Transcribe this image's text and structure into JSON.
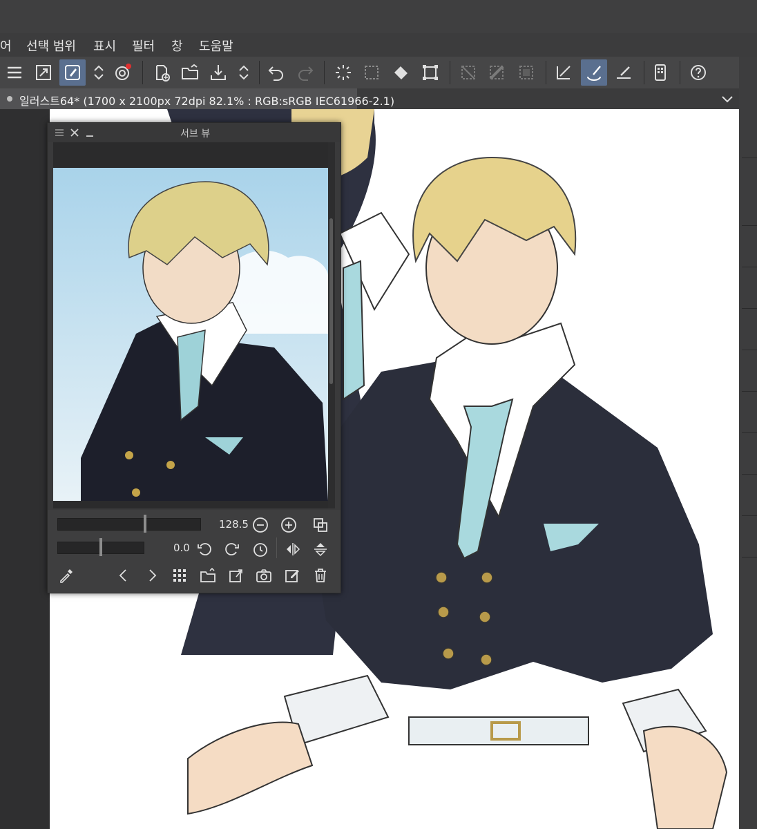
{
  "menu": {
    "items": [
      "어",
      "선택 범위",
      "표시",
      "필터",
      "창",
      "도움말"
    ]
  },
  "toolbar": {
    "icons": [
      "menu-icon",
      "fit-view-icon",
      "brush-active-icon",
      "up-down-arrows-icon",
      "cloud-sync-icon",
      "new-file-icon",
      "open-folder-icon",
      "export-icon",
      "up-down-arrows-icon",
      "undo-icon",
      "redo-icon",
      "auto-select-icon",
      "selection-invert-icon",
      "fill-icon",
      "transform-icon",
      "clear-selection-icon",
      "deselect-icon",
      "border-icon",
      "ruler-icon",
      "brush-settings-icon",
      "pen-line-icon",
      "device-icon",
      "help-icon"
    ]
  },
  "document": {
    "tab_label": "일러스트64* (1700 x 2100px 72dpi 82.1% : RGB:sRGB IEC61966-2.1)"
  },
  "subview": {
    "title": "서브 뷰",
    "zoom_value": "128.5",
    "rotation_value": "0.0",
    "zoom_fraction": 0.61,
    "rotation_fraction": 0.5
  },
  "colors": {
    "accent": "#5a6f8f",
    "panel_bg": "#3a3a3b",
    "canvas_bg": "#ffffff",
    "notify_dot": "#e03030"
  }
}
